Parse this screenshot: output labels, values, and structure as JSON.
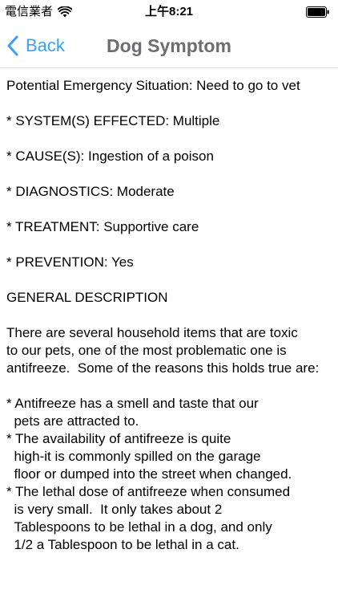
{
  "status_bar": {
    "carrier": "電信業者",
    "time": "上午8:21",
    "wifi_icon": "wifi-icon",
    "battery_icon": "battery-icon"
  },
  "nav": {
    "back_label": "Back",
    "back_icon": "chevron-left-icon",
    "title": "Dog Symptom",
    "accent_color": "#3aa2f6",
    "title_color": "#6d6d72"
  },
  "content": {
    "text": "Potential Emergency Situation: Need to go to vet\n\n* SYSTEM(S) EFFECTED: Multiple\n\n* CAUSE(S): Ingestion of a poison\n\n* DIAGNOSTICS: Moderate\n\n* TREATMENT: Supportive care\n\n* PREVENTION: Yes\n\nGENERAL DESCRIPTION\n\nThere are several household items that are toxic\nto our pets, one of the most problematic one is antifreeze.  Some of the reasons this holds true are:\n\n* Antifreeze has a smell and taste that our\n  pets are attracted to.\n* The availability of antifreeze is quite\n  high-it is commonly spilled on the garage\n  floor or dumped into the street when changed.\n* The lethal dose of antifreeze when consumed\n  is very small.  It only takes about 2\n  Tablespoons to be lethal in a dog, and only\n  1/2 a Tablespoon to be lethal in a cat."
  }
}
